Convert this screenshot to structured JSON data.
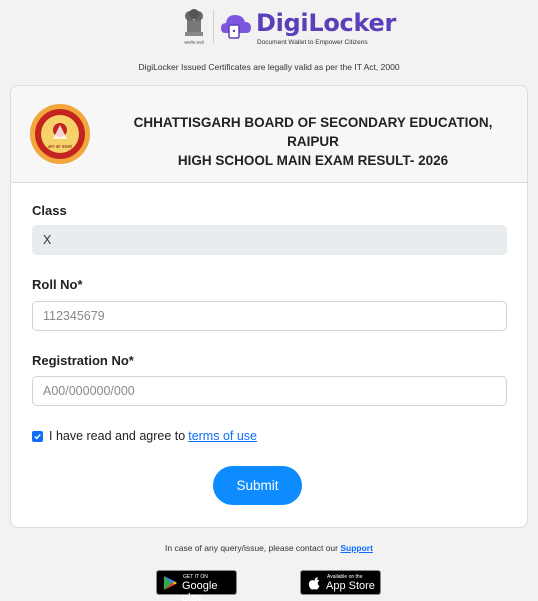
{
  "header": {
    "brand_name": "DigiLocker",
    "brand_tagline": "Document Wallet to Empower Citizens",
    "emblem_caption": "सत्यमेव जयते",
    "legal_notice": "DigiLocker Issued Certificates are legally valid as per the IT Act, 2000"
  },
  "card": {
    "title_line1": "CHHATTISGARH BOARD OF SECONDARY EDUCATION, RAIPUR",
    "title_line2": "HIGH SCHOOL MAIN EXAM RESULT- 2026",
    "seal_text": "ज्ञान का प्रकाश"
  },
  "form": {
    "class_label": "Class",
    "class_value": "X",
    "roll_label": "Roll No*",
    "roll_placeholder": "112345679",
    "reg_label": "Registration No*",
    "reg_placeholder": "A00/000000/000",
    "agree_text": "I have read and agree to",
    "terms_link": "terms of use",
    "agree_checked": true,
    "submit_label": "Submit"
  },
  "footer": {
    "query_text": "In case of any query/issue, please contact our",
    "support_link": "Support",
    "google_small": "GET IT ON",
    "google_big": "Google play",
    "apple_small": "Available on the",
    "apple_big": "App Store"
  },
  "colors": {
    "brand_purple": "#5b3fb9",
    "primary_blue": "#0d8bff",
    "link_blue": "#0d6efd"
  }
}
